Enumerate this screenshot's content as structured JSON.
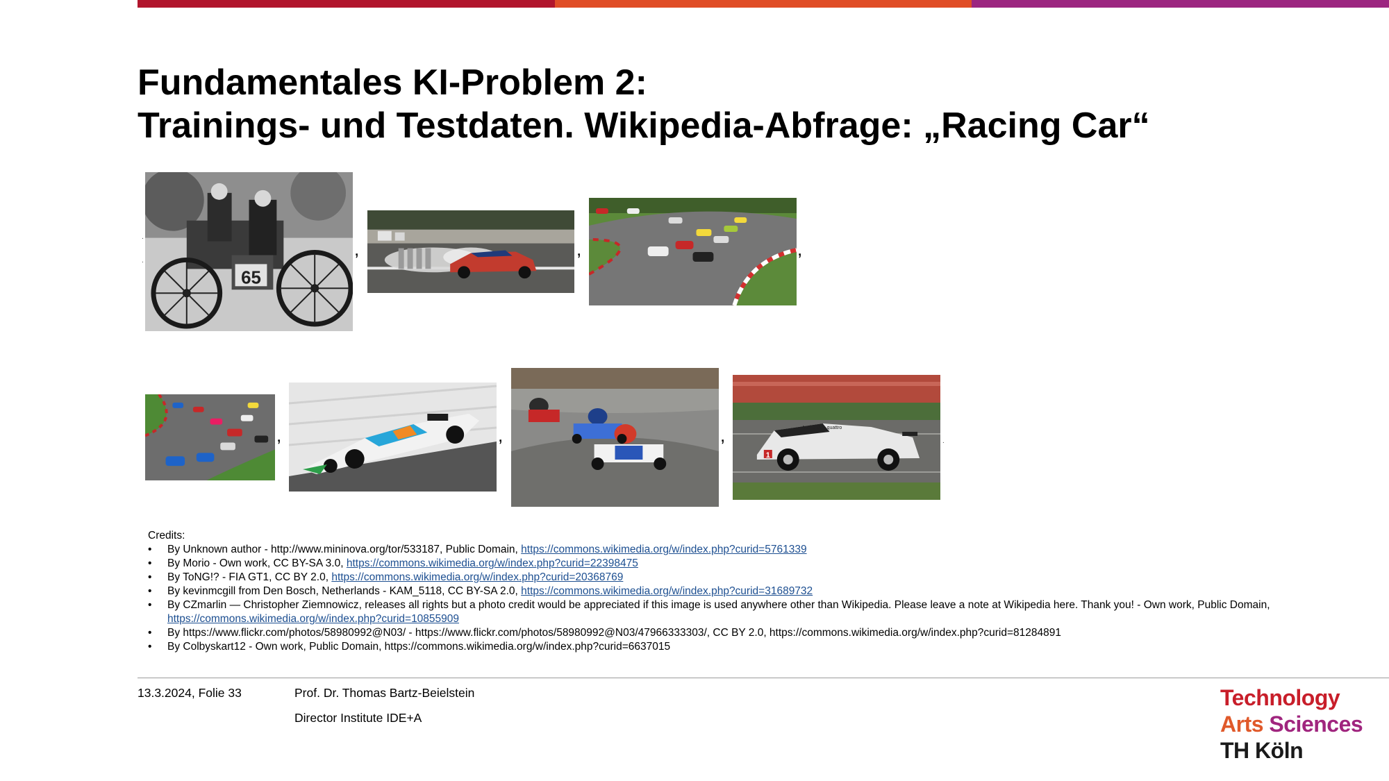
{
  "title": {
    "line1": "Fundamentales KI-Problem 2:",
    "line2": "Trainings- und Testdaten. Wikipedia-Abfrage: „Racing Car“"
  },
  "separators": {
    "comma": ",",
    "dot": "."
  },
  "photos": [
    {
      "name": "vintage-race-car-photo",
      "plate": "65"
    },
    {
      "name": "drag-race-photo"
    },
    {
      "name": "gt-race-track-photo"
    },
    {
      "name": "touring-car-pack-photo"
    },
    {
      "name": "indycar-photo"
    },
    {
      "name": "go-kart-photo"
    },
    {
      "name": "le-mans-prototype-photo",
      "livery": "Audi e-tron quattro",
      "number": "1"
    }
  ],
  "credits": {
    "heading": "Credits:",
    "items": [
      {
        "text": "By Unknown author - http://www.mininova.org/tor/533187, Public Domain, ",
        "link": "https://commons.wikimedia.org/w/index.php?curid=5761339"
      },
      {
        "text": "By Morio - Own work, CC BY-SA 3.0, ",
        "link": "https://commons.wikimedia.org/w/index.php?curid=22398475"
      },
      {
        "text": "By ToNG!? - FIA GT1, CC BY 2.0, ",
        "link": "https://commons.wikimedia.org/w/index.php?curid=20368769"
      },
      {
        "text": "By kevinmcgill from Den Bosch, Netherlands - KAM_5118, CC BY-SA 2.0, ",
        "link": "https://commons.wikimedia.org/w/index.php?curid=31689732"
      },
      {
        "text": "By CZmarlin — Christopher Ziemnowicz, releases all rights but a photo credit would be appreciated if this image is used anywhere other than Wikipedia. Please leave a note at Wikipedia here. Thank you! - Own work, Public Domain, ",
        "link": "https://commons.wikimedia.org/w/index.php?curid=10855909"
      },
      {
        "text": "By https://www.flickr.com/photos/58980992@N03/ - https://www.flickr.com/photos/58980992@N03/47966333303/, CC BY 2.0, https://commons.wikimedia.org/w/index.php?curid=81284891",
        "link": ""
      },
      {
        "text": "By Colbyskart12 - Own work, Public Domain, https://commons.wikimedia.org/w/index.php?curid=6637015",
        "link": ""
      }
    ]
  },
  "footer": {
    "date_slide": "13.3.2024, Folie 33",
    "author": "Prof. Dr. Thomas Bartz-Beielstein",
    "role": "Director Institute IDE+A"
  },
  "logo": {
    "line1": "Technology",
    "line2_a": "Arts",
    "line2_b": "Sciences",
    "line3": "TH Köln"
  },
  "colors": {
    "bar_red": "#b1152c",
    "bar_orange": "#e04d26",
    "bar_purple": "#9c2680",
    "link": "#1d4f91",
    "logo_red": "#c81e2a",
    "logo_orange": "#e0592a",
    "logo_purple": "#a0257e",
    "logo_black": "#1a1a1a"
  }
}
